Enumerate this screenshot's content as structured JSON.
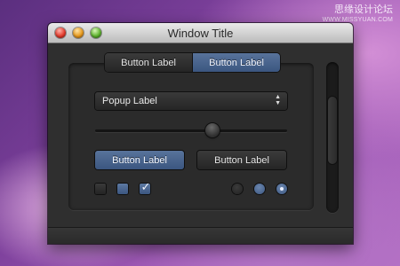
{
  "watermark": {
    "line1": "思缘设计论坛",
    "line2": "WWW.MISSYUAN.COM"
  },
  "window": {
    "title": "Window Title",
    "controls": [
      "close",
      "minimize",
      "zoom"
    ]
  },
  "segmented_control": {
    "segments": [
      {
        "label": "Button Label",
        "selected": false
      },
      {
        "label": "Button Label",
        "selected": true
      }
    ]
  },
  "popup": {
    "label": "Popup Label",
    "arrows_icon": "up-down-arrows-icon"
  },
  "slider": {
    "value_fraction": 0.61
  },
  "buttons": {
    "primary_label": "Button Label",
    "secondary_label": "Button Label"
  },
  "checkboxes": [
    {
      "state": "unchecked",
      "style": "dark"
    },
    {
      "state": "mixed",
      "style": "blue"
    },
    {
      "state": "checked",
      "style": "blue"
    }
  ],
  "radios": [
    {
      "state": "unselected",
      "style": "dark"
    },
    {
      "state": "unselected",
      "style": "blue"
    },
    {
      "state": "selected",
      "style": "blue"
    }
  ],
  "colors": {
    "accent_blue": "#4a6590",
    "window_dark": "#2d2d2d"
  }
}
